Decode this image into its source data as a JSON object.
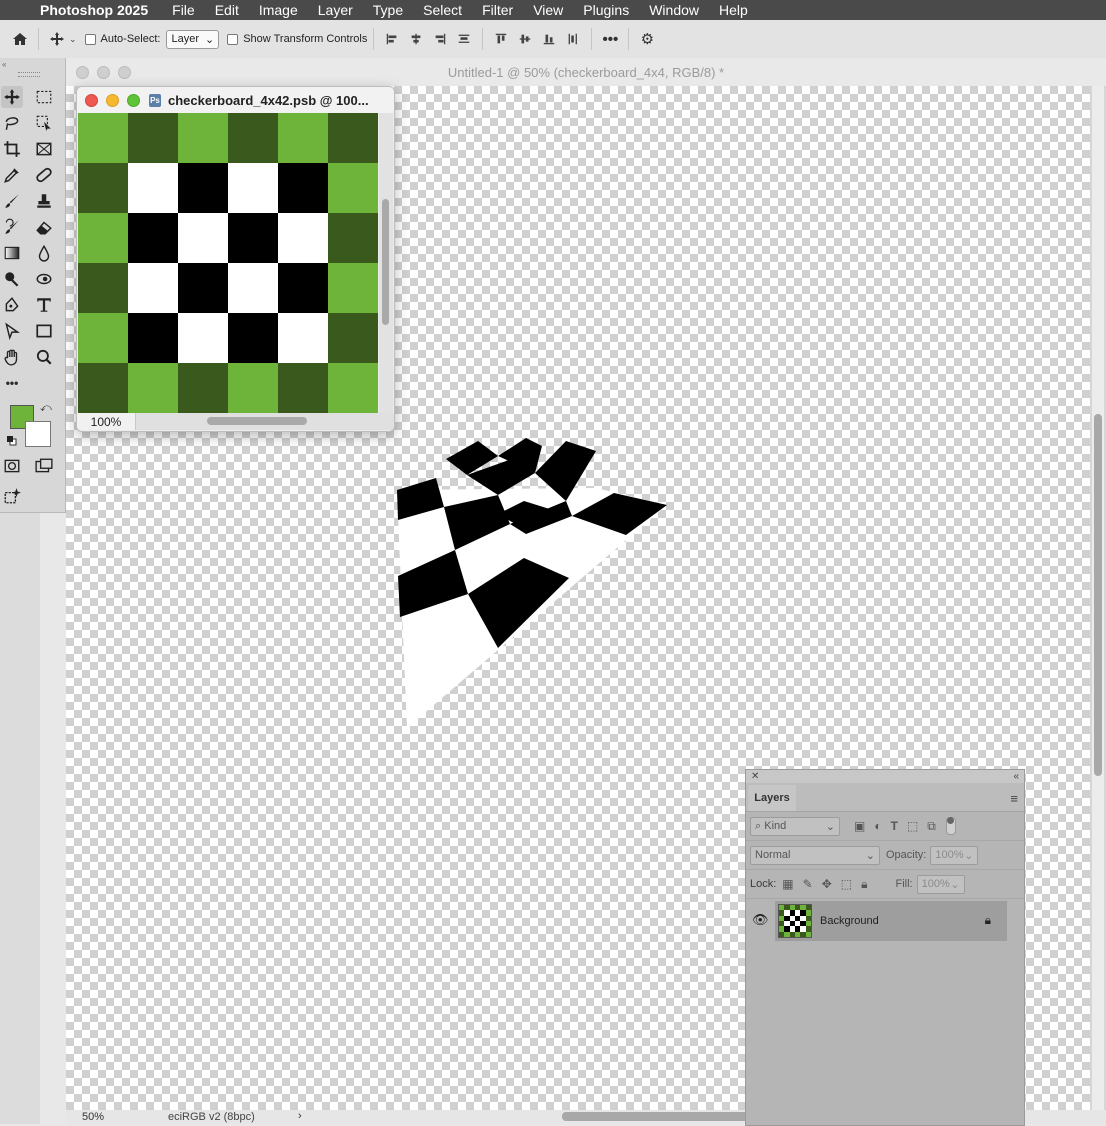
{
  "menubar": {
    "app_name": "Photoshop 2025",
    "items": [
      "File",
      "Edit",
      "Image",
      "Layer",
      "Type",
      "Select",
      "Filter",
      "View",
      "Plugins",
      "Window",
      "Help"
    ]
  },
  "options_bar": {
    "auto_select_label": "Auto-Select:",
    "auto_select_value": "Layer",
    "show_transform_label": "Show Transform Controls"
  },
  "document": {
    "title": "Untitled-1 @ 50% (checkerboard_4x4, RGB/8) *",
    "zoom": "50%",
    "color_profile": "eciRGB v2 (8bpc)",
    "status_arrow": "›"
  },
  "smart_object_window": {
    "title": "checkerboard_4x42.psb @ 100...",
    "zoom": "100%",
    "tile_colors": {
      "light_green": "#6fb43a",
      "dark_green": "#3a5a1d",
      "white": "#ffffff",
      "black": "#000000"
    }
  },
  "colors": {
    "foreground": "#6fb43a",
    "background": "#ffffff"
  },
  "layers_panel": {
    "tab": "Layers",
    "filter_kind": "Kind",
    "blend_mode": "Normal",
    "opacity_label": "Opacity:",
    "opacity_value": "100%",
    "lock_label": "Lock:",
    "fill_label": "Fill:",
    "fill_value": "100%",
    "layers": [
      {
        "name": "Background",
        "locked": true,
        "visible": true
      }
    ]
  }
}
